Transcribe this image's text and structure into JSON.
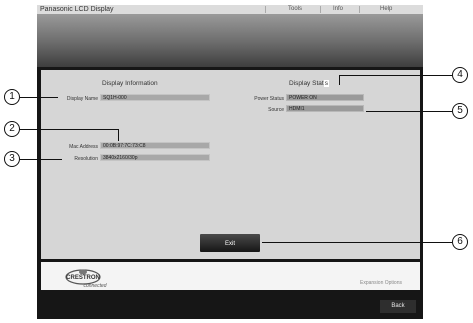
{
  "window": {
    "title": "Panasonic LCD Display"
  },
  "menu": {
    "tools": "Tools",
    "info": "Info",
    "help": "Help"
  },
  "display_info": {
    "heading": "Display Information",
    "display_name_label": "Display Name",
    "display_name_value": "SQ1H-000",
    "mac_label": "Mac Address",
    "mac_value": "00:0B:97:7C:73:C8",
    "resolution_label": "Resolution",
    "resolution_value": "3840x2160/30p"
  },
  "display_status": {
    "heading": "Display Stat",
    "heading_suffix": "s",
    "power_label": "Power Status",
    "power_value": "POWER ON",
    "source_label": "Source",
    "source_value": "HDMI1"
  },
  "buttons": {
    "exit": "Exit",
    "back": "Back"
  },
  "footer": {
    "logo_brand": "CRESTRON",
    "logo_sub": "connected",
    "expansion": "Expansion Options"
  },
  "callouts": [
    "1",
    "2",
    "3",
    "4",
    "5",
    "6"
  ]
}
